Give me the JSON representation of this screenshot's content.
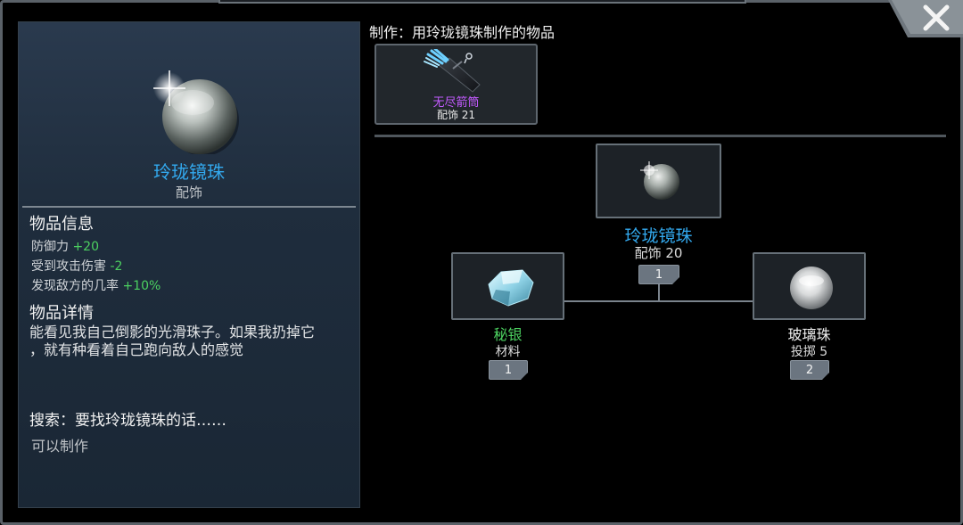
{
  "item": {
    "name": "玲珑镜珠",
    "category": "配饰",
    "info_title": "物品信息",
    "stats": [
      {
        "label": "防御力",
        "value": "+20"
      },
      {
        "label": "受到攻击伤害",
        "value": "-2"
      },
      {
        "label": "发现敌方的几率",
        "value": "+10%"
      }
    ],
    "detail_title": "物品详情",
    "detail_line1": "能看见我自己倒影的光滑珠子。如果我扔掉它",
    "detail_line2": "，就有种看着自己跑向敌人的感觉",
    "search_title": "搜索：要找玲珑镜珠的话……",
    "search_result": "可以制作"
  },
  "crafting": {
    "title": "制作：用玲珑镜珠制作的物品",
    "products": [
      {
        "name": "无尽箭筒",
        "sub": "配饰 21",
        "icon": "quiver-icon",
        "rarity_color": "#c35bff"
      }
    ]
  },
  "recipe": {
    "result": {
      "name": "玲珑镜珠",
      "sub": "配饰 20",
      "count": "1",
      "icon": "crystal-orb-icon"
    },
    "ingredients": [
      {
        "name": "秘银",
        "sub": "材料",
        "count": "1",
        "icon": "mithril-ore-icon",
        "name_color": "#4cd060"
      },
      {
        "name": "玻璃珠",
        "sub": "投掷 5",
        "count": "2",
        "icon": "glass-bead-icon",
        "name_color": "#f0f0f0"
      }
    ]
  },
  "colors": {
    "accent_blue": "#33aaf0",
    "stat_green": "#4cd060",
    "rare_purple": "#c35bff"
  }
}
